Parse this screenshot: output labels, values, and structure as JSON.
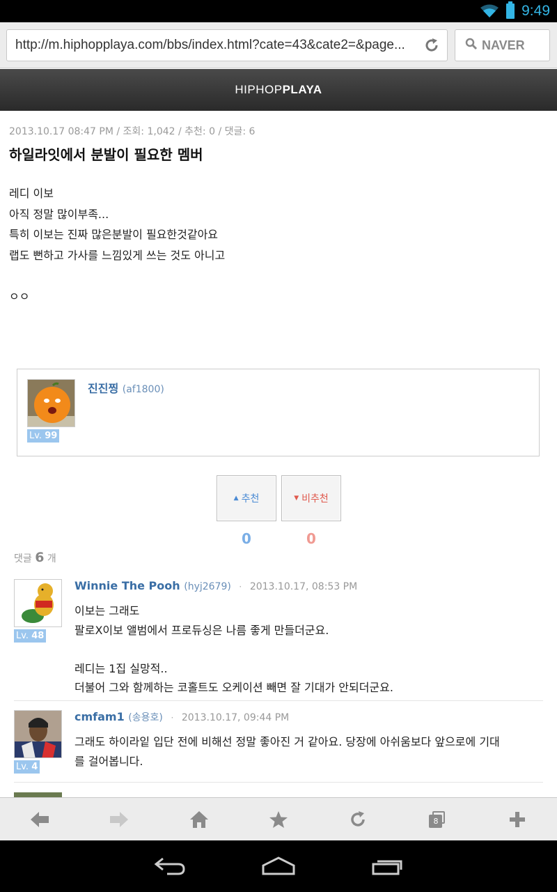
{
  "status": {
    "time": "9:49"
  },
  "browser": {
    "url": "http://m.hiphopplaya.com/bbs/index.html?cate=43&cate2=&page...",
    "search_placeholder": "NAVER"
  },
  "site": {
    "logo_light": "HIPHOP",
    "logo_bold": "PLAYA"
  },
  "post": {
    "meta": "2013.10.17 08:47 PM / 조회: 1,042 / 추천: 0 / 댓글: 6",
    "title": "하일라잇에서 분발이 필요한 멤버",
    "body": [
      "레디 이보",
      "아직 정말 많이부족...",
      "특히 이보는 진짜 많은분발이 필요한것같아요",
      "랩도 뻔하고 가사를 느낌있게 쓰는 것도 아니고",
      "",
      "ㅇㅇ"
    ],
    "author": {
      "name": "진진찡",
      "id": "(af1800)",
      "level_prefix": "Lv.",
      "level": "99"
    }
  },
  "vote": {
    "up_label": "추천",
    "down_label": "비추천",
    "up_count": "0",
    "down_count": "0",
    "colors": {
      "up": "#4a8ad4",
      "down": "#e05a4e"
    }
  },
  "comments": {
    "label": "댓글",
    "count": "6",
    "unit": "개",
    "items": [
      {
        "name": "Winnie The Pooh",
        "id": "(hyj2679)",
        "date": "2013.10.17, 08:53 PM",
        "level_prefix": "Lv.",
        "level": "48",
        "lines": [
          "이보는 그래도",
          "팔로X이보 앨범에서 프로듀싱은 나름 좋게 만들더군요.",
          "",
          "레디는 1집 실망적..",
          "더불어 그와 함께하는 코홀트도 오케이션 빼면 잘 기대가 안되더군요."
        ]
      },
      {
        "name": "cmfam1",
        "id": "(송용호)",
        "date": "2013.10.17, 09:44 PM",
        "level_prefix": "Lv.",
        "level": "4",
        "lines": [
          "그래도 하이라잍 입단 전에 비해선 정말 좋아진 거 같아요. 당장에 아쉬움보다 앞으로에 기대",
          "를 걸어봅니다."
        ]
      }
    ]
  },
  "toolbar": {
    "tab_count": "8"
  }
}
